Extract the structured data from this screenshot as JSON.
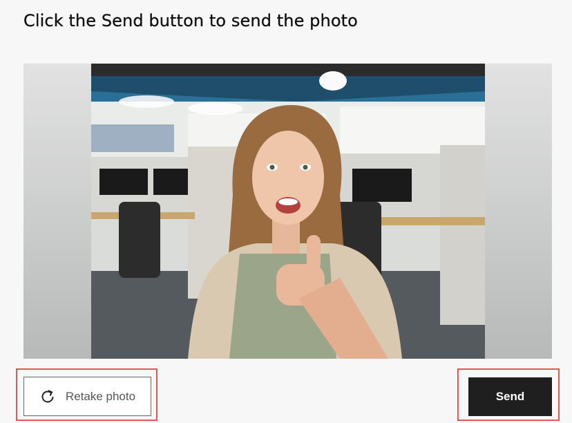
{
  "header": {
    "title": "Click the Send button to send the photo"
  },
  "preview": {
    "icon": "photo-preview"
  },
  "actions": {
    "retake_label": "Retake photo",
    "retake_icon": "refresh-icon",
    "send_label": "Send",
    "send_bg": "#1f1f1f",
    "highlight_color": "#e05555"
  }
}
